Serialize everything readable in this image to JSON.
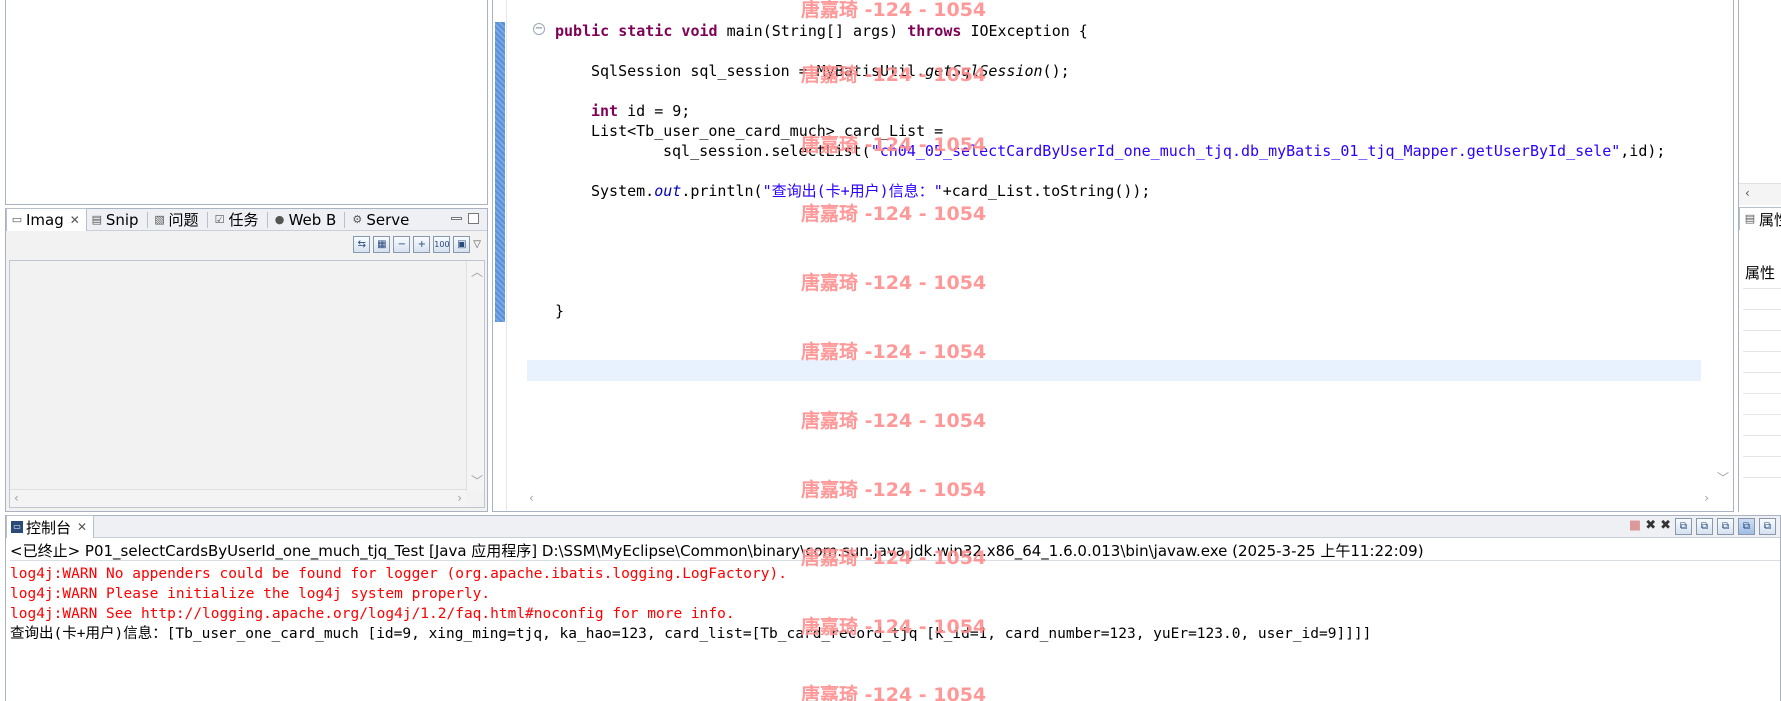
{
  "image_view": {
    "tabs": [
      {
        "label": "Imag",
        "icon": "image-icon",
        "active": true
      },
      {
        "label": "Snip",
        "icon": "snippet-icon"
      },
      {
        "label": "问题",
        "icon": "problems-icon"
      },
      {
        "label": "任务",
        "icon": "tasks-icon"
      },
      {
        "label": "Web B",
        "icon": "globe-icon"
      },
      {
        "label": "Serve",
        "icon": "servers-icon"
      }
    ],
    "toolbar_glyphs": [
      "⇆",
      "▦",
      "−",
      "+",
      "100",
      "▣"
    ]
  },
  "editor": {
    "lines": [
      {
        "parts": [
          [
            "kw",
            "public static void "
          ],
          [
            "",
            "main(String[] args) "
          ],
          [
            "kw",
            "throws "
          ],
          [
            "",
            "IOException {"
          ]
        ]
      },
      {
        "parts": [
          [
            "",
            "SqlSession sql_session = MyBatisUtil."
          ],
          [
            "ital",
            "getSqlSession"
          ],
          [
            "",
            "();"
          ]
        ]
      },
      {
        "parts": [
          [
            "kw",
            "int "
          ],
          [
            "",
            "id = 9;"
          ]
        ]
      },
      {
        "parts": [
          [
            "",
            "List<Tb_user_one_card_much> card_List ="
          ]
        ]
      },
      {
        "parts": [
          [
            "",
            "sql_session.selectList("
          ],
          [
            "str",
            "\"ch04_05_selectCardByUserId_one_much_tjq.db_myBatis_01_tjq_Mapper.getUserById_sele\""
          ],
          [
            "",
            ",id);"
          ]
        ]
      },
      {
        "parts": [
          [
            "",
            "System."
          ],
          [
            "field",
            "out"
          ],
          [
            "",
            ".println("
          ],
          [
            "str",
            "\"查询出(卡+用户)信息：\""
          ],
          [
            "",
            "+card_List.toString());"
          ]
        ]
      },
      {
        "parts": [
          [
            "",
            "}"
          ]
        ]
      },
      {
        "parts": [
          [
            "",
            "}"
          ]
        ]
      }
    ]
  },
  "right_panel": {
    "tab_label": "属性",
    "header": "属性"
  },
  "console": {
    "tab_label": "控制台",
    "header": "<已终止> P01_selectCardsByUserId_one_much_tjq_Test [Java 应用程序] D:\\SSM\\MyEclipse\\Common\\binary\\com.sun.java.jdk.win32.x86_64_1.6.0.013\\bin\\javaw.exe  (2025-3-25 上午11:22:09)",
    "lines": [
      {
        "text": "log4j:WARN No appenders could be found for logger (org.apache.ibatis.logging.LogFactory).",
        "error": true
      },
      {
        "text": "log4j:WARN Please initialize the log4j system properly.",
        "error": true
      },
      {
        "text": "log4j:WARN See http://logging.apache.org/log4j/1.2/faq.html#noconfig for more info.",
        "error": true
      },
      {
        "text": "查询出(卡+用户)信息：[Tb_user_one_card_much [id=9, xing_ming=tjq, ka_hao=123, card_list=[Tb_card_record_tjq [k_id=1, card_number=123, yuEr=123.0, user_id=9]]]]",
        "error": false
      }
    ],
    "toolbar_glyphs": [
      "■",
      "✖",
      "✖",
      "⧉",
      "⧉",
      "⧉",
      "⧉",
      "⧉"
    ]
  },
  "watermark": {
    "text": "唐嘉琦 -124 - 1054",
    "color": "#ff8f8f"
  },
  "colors": {
    "keyword": "#7f0055",
    "string": "#2a00ff",
    "error": "#ff0000",
    "current_line": "#e8f2fe"
  }
}
